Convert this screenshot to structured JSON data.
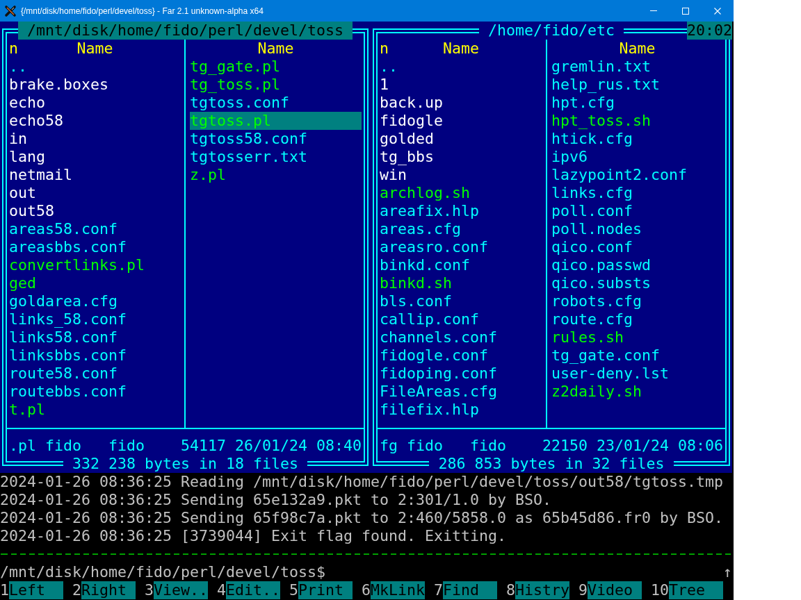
{
  "window": {
    "title": "{/mnt/disk/home/fido/perl/devel/toss} - Far 2.1 unknown-alpha x64"
  },
  "clock": "20:02",
  "panels": [
    {
      "path": "/mnt/disk/home/fido/perl/devel/toss",
      "active": true,
      "sort_mark": "n",
      "columns": [
        {
          "header": "Name",
          "files": [
            {
              "name": "..",
              "kind": "updir",
              "selected": false
            },
            {
              "name": "brake.boxes",
              "kind": "dir",
              "selected": false
            },
            {
              "name": "echo",
              "kind": "dir",
              "selected": false
            },
            {
              "name": "echo58",
              "kind": "dir",
              "selected": false
            },
            {
              "name": "in",
              "kind": "dir",
              "selected": false
            },
            {
              "name": "lang",
              "kind": "dir",
              "selected": false
            },
            {
              "name": "netmail",
              "kind": "dir",
              "selected": false
            },
            {
              "name": "out",
              "kind": "dir",
              "selected": false
            },
            {
              "name": "out58",
              "kind": "dir",
              "selected": false
            },
            {
              "name": "areas58.conf",
              "kind": "file",
              "selected": false
            },
            {
              "name": "areasbbs.conf",
              "kind": "file",
              "selected": false
            },
            {
              "name": "convertlinks.pl",
              "kind": "exec",
              "selected": false
            },
            {
              "name": "ged",
              "kind": "exec",
              "selected": false
            },
            {
              "name": "goldarea.cfg",
              "kind": "file",
              "selected": false
            },
            {
              "name": "links_58.conf",
              "kind": "file",
              "selected": false
            },
            {
              "name": "links58.conf",
              "kind": "file",
              "selected": false
            },
            {
              "name": "linksbbs.conf",
              "kind": "file",
              "selected": false
            },
            {
              "name": "route58.conf",
              "kind": "file",
              "selected": false
            },
            {
              "name": "routebbs.conf",
              "kind": "file",
              "selected": false
            },
            {
              "name": "t.pl",
              "kind": "exec",
              "selected": false
            }
          ]
        },
        {
          "header": "Name",
          "files": [
            {
              "name": "tg_gate.pl",
              "kind": "exec",
              "selected": false
            },
            {
              "name": "tg_toss.pl",
              "kind": "exec",
              "selected": false
            },
            {
              "name": "tgtoss.conf",
              "kind": "file",
              "selected": false
            },
            {
              "name": "tgtoss.pl",
              "kind": "exec",
              "selected": true
            },
            {
              "name": "tgtoss58.conf",
              "kind": "file",
              "selected": false
            },
            {
              "name": "tgtosserr.txt",
              "kind": "file",
              "selected": false
            },
            {
              "name": "z.pl",
              "kind": "exec",
              "selected": false
            }
          ]
        }
      ],
      "info": {
        "name": ".pl",
        "owner": "fido",
        "group": "fido",
        "size": "54117",
        "date": "26/01/24",
        "time": "08:40"
      },
      "summary": "332 238 bytes in 18 files"
    },
    {
      "path": "/home/fido/etc",
      "active": false,
      "sort_mark": "n",
      "columns": [
        {
          "header": "Name",
          "files": [
            {
              "name": "..",
              "kind": "updir",
              "selected": false
            },
            {
              "name": "1",
              "kind": "dir",
              "selected": false
            },
            {
              "name": "back.up",
              "kind": "dir",
              "selected": false
            },
            {
              "name": "fidogle",
              "kind": "dir",
              "selected": false
            },
            {
              "name": "golded",
              "kind": "dir",
              "selected": false
            },
            {
              "name": "tg_bbs",
              "kind": "dir",
              "selected": false
            },
            {
              "name": "win",
              "kind": "dir",
              "selected": false
            },
            {
              "name": "archlog.sh",
              "kind": "exec",
              "selected": false
            },
            {
              "name": "areafix.hlp",
              "kind": "file",
              "selected": false
            },
            {
              "name": "areas.cfg",
              "kind": "file",
              "selected": false
            },
            {
              "name": "areasro.conf",
              "kind": "file",
              "selected": false
            },
            {
              "name": "binkd.conf",
              "kind": "file",
              "selected": false
            },
            {
              "name": "binkd.sh",
              "kind": "exec",
              "selected": false
            },
            {
              "name": "bls.conf",
              "kind": "file",
              "selected": false
            },
            {
              "name": "callip.conf",
              "kind": "file",
              "selected": false
            },
            {
              "name": "channels.conf",
              "kind": "file",
              "selected": false
            },
            {
              "name": "fidogle.conf",
              "kind": "file",
              "selected": false
            },
            {
              "name": "fidoping.conf",
              "kind": "file",
              "selected": false
            },
            {
              "name": "FileAreas.cfg",
              "kind": "file",
              "selected": false
            },
            {
              "name": "filefix.hlp",
              "kind": "file",
              "selected": false
            }
          ]
        },
        {
          "header": "Name",
          "files": [
            {
              "name": "gremlin.txt",
              "kind": "file",
              "selected": false
            },
            {
              "name": "help_rus.txt",
              "kind": "file",
              "selected": false
            },
            {
              "name": "hpt.cfg",
              "kind": "file",
              "selected": false
            },
            {
              "name": "hpt_toss.sh",
              "kind": "exec",
              "selected": false
            },
            {
              "name": "htick.cfg",
              "kind": "file",
              "selected": false
            },
            {
              "name": "ipv6",
              "kind": "file",
              "selected": false
            },
            {
              "name": "lazypoint2.conf",
              "kind": "file",
              "selected": false
            },
            {
              "name": "links.cfg",
              "kind": "file",
              "selected": false
            },
            {
              "name": "poll.conf",
              "kind": "file",
              "selected": false
            },
            {
              "name": "poll.nodes",
              "kind": "file",
              "selected": false
            },
            {
              "name": "qico.conf",
              "kind": "file",
              "selected": false
            },
            {
              "name": "qico.passwd",
              "kind": "file",
              "selected": false
            },
            {
              "name": "qico.substs",
              "kind": "file",
              "selected": false
            },
            {
              "name": "robots.cfg",
              "kind": "file",
              "selected": false
            },
            {
              "name": "route.cfg",
              "kind": "file",
              "selected": false
            },
            {
              "name": "rules.sh",
              "kind": "exec",
              "selected": false
            },
            {
              "name": "tg_gate.conf",
              "kind": "file",
              "selected": false
            },
            {
              "name": "user-deny.lst",
              "kind": "file",
              "selected": false
            },
            {
              "name": "z2daily.sh",
              "kind": "exec",
              "selected": false
            }
          ]
        }
      ],
      "info": {
        "name": "fg",
        "owner": "fido",
        "group": "fido",
        "size": "22150",
        "date": "23/01/24",
        "time": "08:06"
      },
      "summary": "286 853 bytes in 32 files"
    }
  ],
  "log": [
    "2024-01-26 08:36:25 Reading /mnt/disk/home/fido/perl/devel/toss/out58/tgtoss.tmp",
    "2024-01-26 08:36:25 Sending 65e132a9.pkt to 2:301/1.0 by BSO.",
    "2024-01-26 08:36:25 Sending 65f98c7a.pkt to 2:460/5858.0 as 65b45d86.fr0 by BSO.",
    "2024-01-26 08:36:25 [3739044] Exit flag found. Exitting."
  ],
  "command_line": {
    "prompt": "/mnt/disk/home/fido/perl/devel/toss$",
    "scroll_mark": "↑"
  },
  "keybar": [
    {
      "key": "1",
      "label": "Left"
    },
    {
      "key": "2",
      "label": "Right"
    },
    {
      "key": "3",
      "label": "View.."
    },
    {
      "key": "4",
      "label": "Edit.."
    },
    {
      "key": "5",
      "label": "Print"
    },
    {
      "key": "6",
      "label": "MkLink"
    },
    {
      "key": "7",
      "label": "Find"
    },
    {
      "key": "8",
      "label": "Histry"
    },
    {
      "key": "9",
      "label": "Video"
    },
    {
      "key": "10",
      "label": "Tree"
    }
  ]
}
